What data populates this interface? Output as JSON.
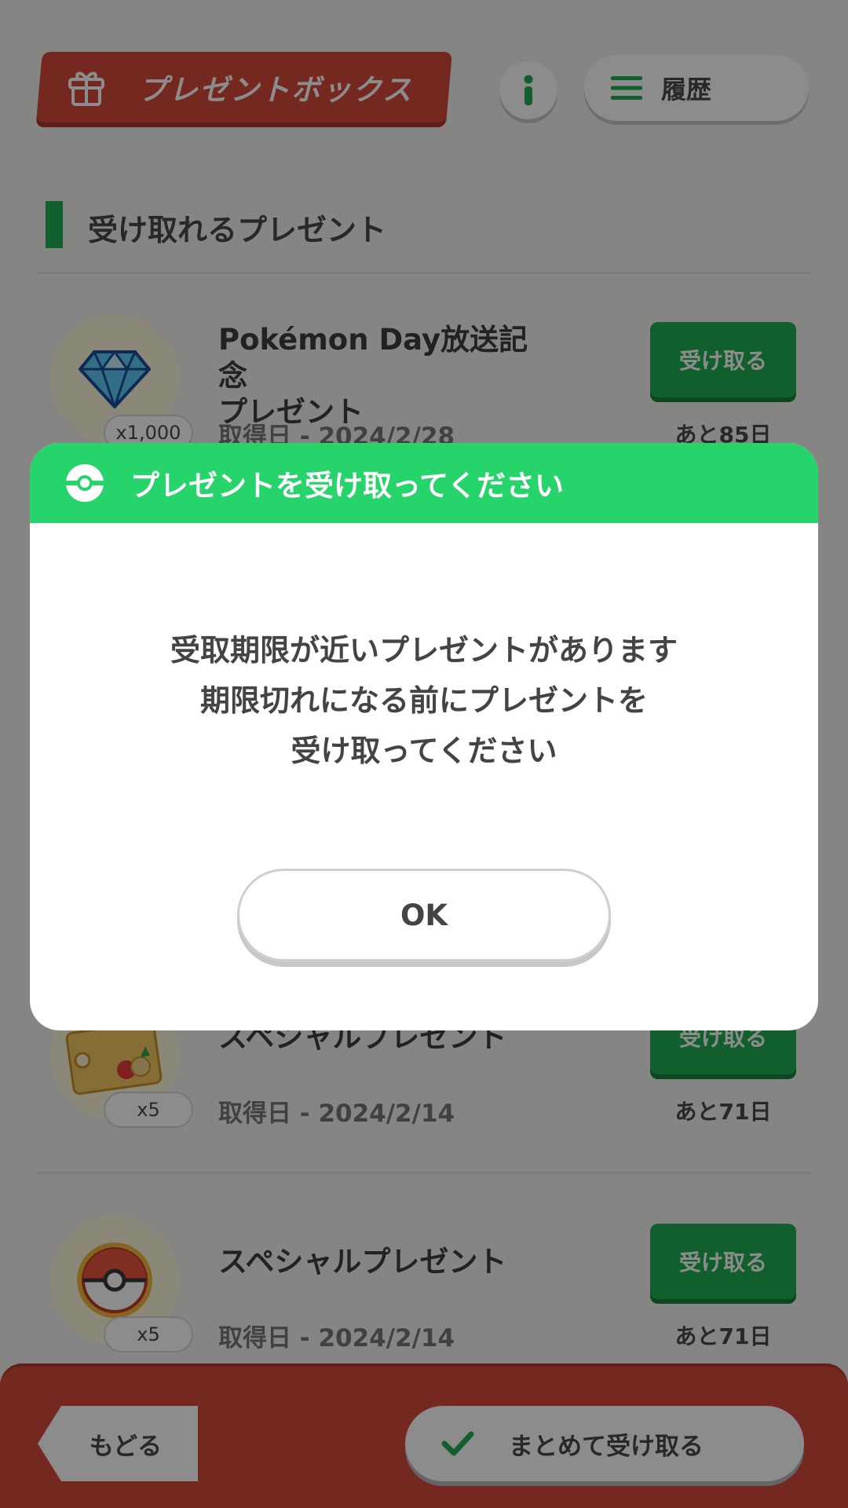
{
  "header": {
    "present_box_label": "プレゼントボックス",
    "history_label": "履歴"
  },
  "section": {
    "title": "受け取れるプレゼント"
  },
  "items": [
    {
      "icon": "diamond-gem",
      "quantity": "x1,000",
      "name_line1": "Pokémon Day放送記念",
      "name_line2": "プレゼント",
      "date": "取得日 - 2024/2/28",
      "button": "受け取る",
      "remaining": "あと85日"
    },
    {
      "icon": "food-ticket",
      "quantity": "x5",
      "name_line1": "スペシャルプレゼント",
      "date": "取得日 - 2024/2/14",
      "button": "受け取る",
      "remaining": "あと71日"
    },
    {
      "icon": "poke-ball",
      "quantity": "x5",
      "name_line1": "スペシャルプレゼント",
      "date": "取得日 - 2024/2/14",
      "button": "受け取る",
      "remaining": "あと71日"
    }
  ],
  "footer": {
    "back_label": "もどる",
    "bulk_receive_label": "まとめて受け取る"
  },
  "dialog": {
    "title": "プレゼントを受け取ってください",
    "message_line1": "受取期限が近いプレゼントがあります",
    "message_line2": "期限切れになる前にプレゼントを",
    "message_line3": "受け取ってください",
    "ok_label": "OK"
  },
  "colors": {
    "brand_red": "#d4493b",
    "receive_green": "#1fae50",
    "dialog_header_green": "#27d46b",
    "section_accent": "#1fb052"
  }
}
